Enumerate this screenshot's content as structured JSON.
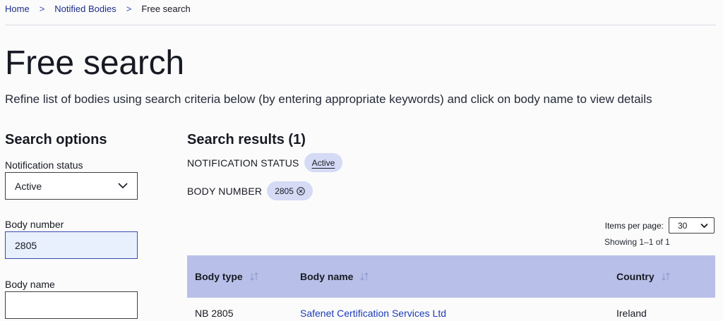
{
  "breadcrumb": {
    "home": "Home",
    "section": "Notified Bodies",
    "current": "Free search",
    "separator": ">"
  },
  "page": {
    "title": "Free search",
    "subtitle": "Refine list of bodies using search criteria below (by entering appropriate keywords) and click on body name to view details"
  },
  "search_options": {
    "heading": "Search options",
    "notification_status": {
      "label": "Notification status",
      "value": "Active"
    },
    "body_number": {
      "label": "Body number",
      "value": "2805"
    },
    "body_name": {
      "label": "Body name",
      "value": "",
      "placeholder": ""
    }
  },
  "results": {
    "heading": "Search results (1)",
    "filters": [
      {
        "label": "NOTIFICATION STATUS",
        "chip": "Active"
      },
      {
        "label": "BODY NUMBER",
        "chip": "2805"
      }
    ],
    "items_per_page_label": "Items per page:",
    "items_per_page_value": "30",
    "showing": "Showing 1–1 of 1",
    "columns": [
      "Body type",
      "Body name",
      "Country"
    ],
    "rows": [
      {
        "body_type": "NB 2805",
        "body_name": "Safenet Certification Services Ltd",
        "country": "Ireland"
      }
    ]
  },
  "icons": {
    "breadcrumb_separator": "chevron-right-icon",
    "select": "chevron-down-icon",
    "remove_chip": "close-circle-icon",
    "sort": "sort-icon"
  },
  "colors": {
    "link": "#1d3cb8",
    "chip_bg": "#d5daf5",
    "table_header_bg": "#b8c0e9",
    "input_filled_bg": "#e8f0fe"
  }
}
